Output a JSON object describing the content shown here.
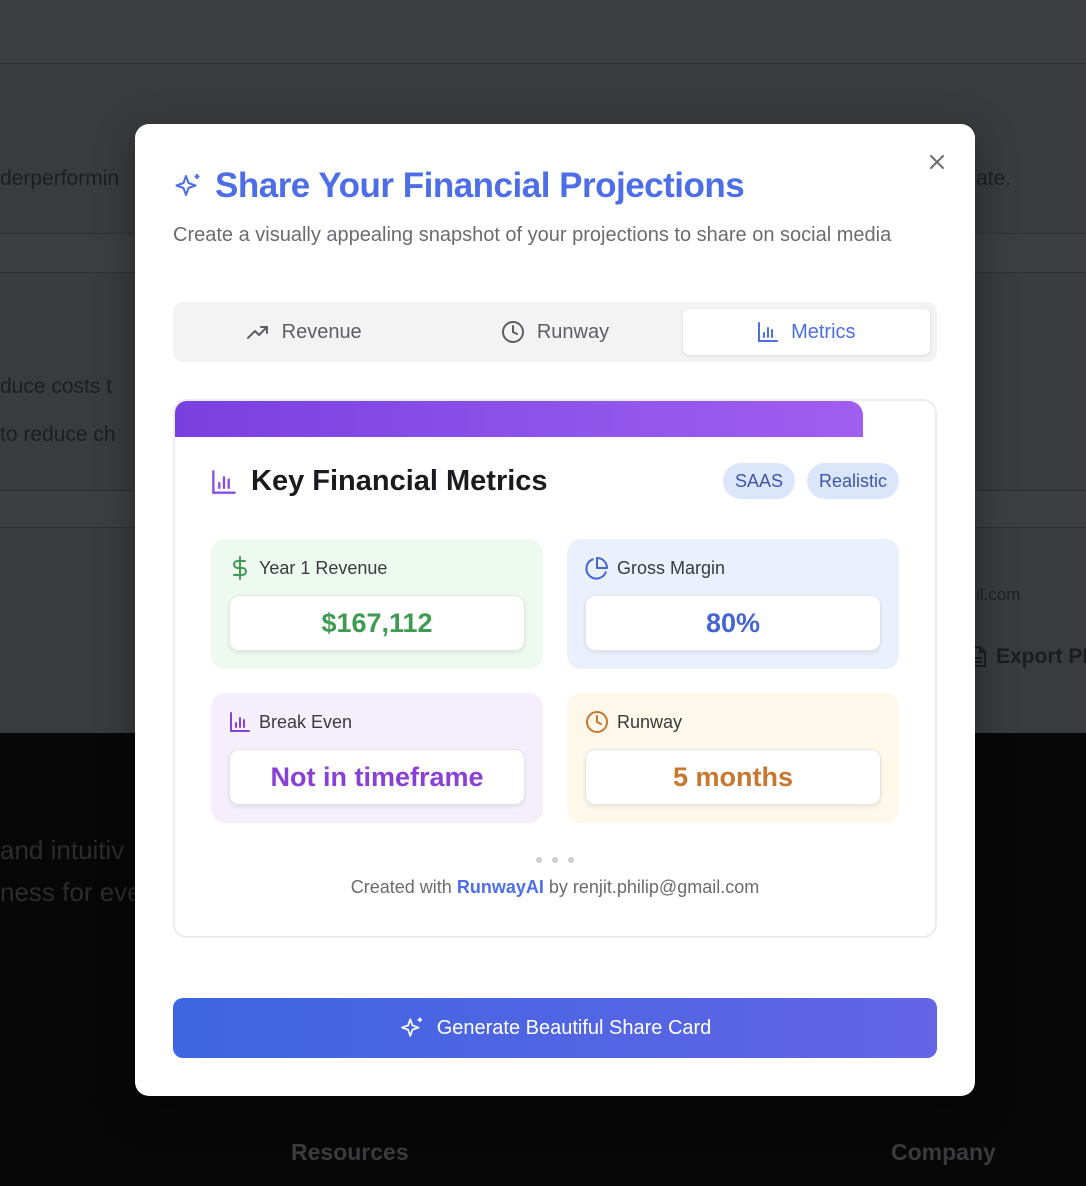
{
  "background": {
    "row1_left": "derperformin",
    "row1_right": "ate.",
    "row2_left": "duce costs t",
    "row3_left": "to reduce ch",
    "email_fragment": "il.com",
    "export_label": "Export PI",
    "dark_line1": "and intuitiv",
    "dark_line2": "ness for eve",
    "footer_resources": "Resources",
    "footer_company": "Company"
  },
  "modal": {
    "title": "Share Your Financial Projections",
    "subtitle": "Create a visually appealing snapshot of your projections to share on social media",
    "tabs": [
      {
        "label": "Revenue",
        "icon": "trending-up-icon",
        "active": false
      },
      {
        "label": "Runway",
        "icon": "clock-icon",
        "active": false
      },
      {
        "label": "Metrics",
        "icon": "bar-chart-icon",
        "active": true
      }
    ],
    "card": {
      "title": "Key Financial Metrics",
      "badges": [
        "SAAS",
        "Realistic"
      ],
      "metrics": {
        "revenue": {
          "label": "Year 1 Revenue",
          "value": "$167,112"
        },
        "gross_margin": {
          "label": "Gross Margin",
          "value": "80%"
        },
        "break_even": {
          "label": "Break Even",
          "value": "Not in timeframe"
        },
        "runway": {
          "label": "Runway",
          "value": "5 months"
        }
      },
      "credit_prefix": "Created with",
      "credit_brand": "RunwayAI",
      "credit_suffix": "by renjit.philip@gmail.com"
    },
    "generate_button": "Generate Beautiful Share Card"
  },
  "colors": {
    "accent": "#4d6ee6",
    "revenue_green": "#3f9a52",
    "margin_blue": "#4466d2",
    "breakeven_purple": "#8a3fd6",
    "runway_orange": "#c9772f",
    "card_bar_purple": "#8f55ea"
  }
}
